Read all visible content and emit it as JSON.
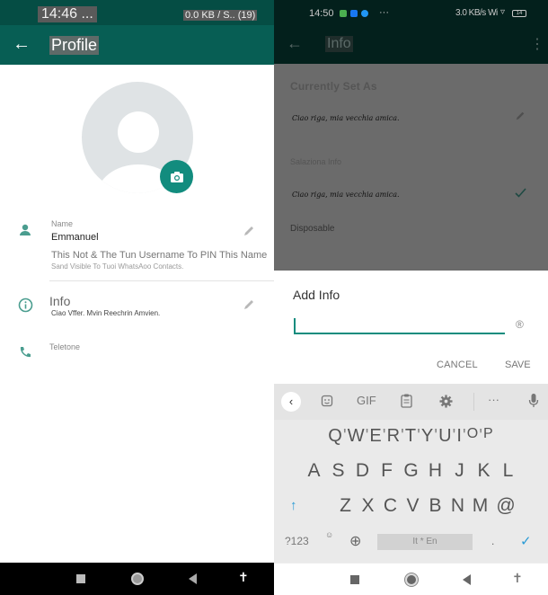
{
  "left": {
    "status_bar": {
      "time": "14:46 ...",
      "network": "0.0 KB / S.. (19)"
    },
    "app_bar": {
      "title": "Profile",
      "back_icon": "arrow-left-icon"
    },
    "avatar": {
      "icon": "default-avatar-icon",
      "camera_icon": "camera-icon"
    },
    "name_section": {
      "label": "Name",
      "value": "Emmanuel",
      "hint": "This Not & The Tun Username To PIN This Name",
      "sub_hint": "Sand Visible To Tuoi WhatsAoo Contacts.",
      "icon": "person-icon",
      "edit_icon": "pencil-icon"
    },
    "info_section": {
      "label": "Info",
      "value": "Ciao Vffer. Mvin Reechrin Amvien.",
      "icon": "info-icon",
      "edit_icon": "pencil-icon"
    },
    "phone_section": {
      "label": "Teletone",
      "icon": "phone-icon"
    },
    "nav_bar": {
      "recent": "square-icon",
      "home": "circle-icon",
      "back": "triangle-back-icon",
      "accessibility": "accessibility-icon"
    }
  },
  "right": {
    "status_bar": {
      "time": "14:50",
      "dots": "···",
      "network": "3.0 KB/s Wi",
      "battery": "14",
      "wifi": "▿"
    },
    "app_bar": {
      "title": "Info",
      "more": "⋮"
    },
    "background_list": {
      "currently_set_as": "Currently Set As",
      "current_value": "Ciao riga, mia vecchia amica.",
      "select_info": "Salaziona Info",
      "option_value": "Ciao riga, mia vecchia amica.",
      "disposable": "Disposable"
    },
    "dialog": {
      "title": "Add Info",
      "input_value": "",
      "emoji_icon": "®",
      "cancel_label": "CANCEL",
      "save_label": "SAVE",
      "accent": "#128c7e"
    },
    "keyboard": {
      "toolbar": {
        "back": "‹",
        "gif": "GIF",
        "more": "···"
      },
      "row1": [
        "Q",
        "W",
        "E",
        "R",
        "T",
        "Y",
        "U",
        "I",
        "O",
        "P"
      ],
      "row2": [
        "A",
        "S",
        "D",
        "F",
        "G",
        "H",
        "J",
        "K",
        "L"
      ],
      "row3": [
        "Z",
        "X",
        "C",
        "V",
        "B",
        "N",
        "M",
        "@"
      ],
      "shift": "↑",
      "symbols": "?123",
      "emoji_comma": "☺",
      "globe": "⊕",
      "space": "It * En",
      "period": ".",
      "enter": "✓"
    }
  },
  "colors": {
    "teal_dark": "#075e54",
    "teal_status": "#054d44",
    "accent_green": "#128c7e",
    "keyboard_blue": "#2a9bd6"
  }
}
